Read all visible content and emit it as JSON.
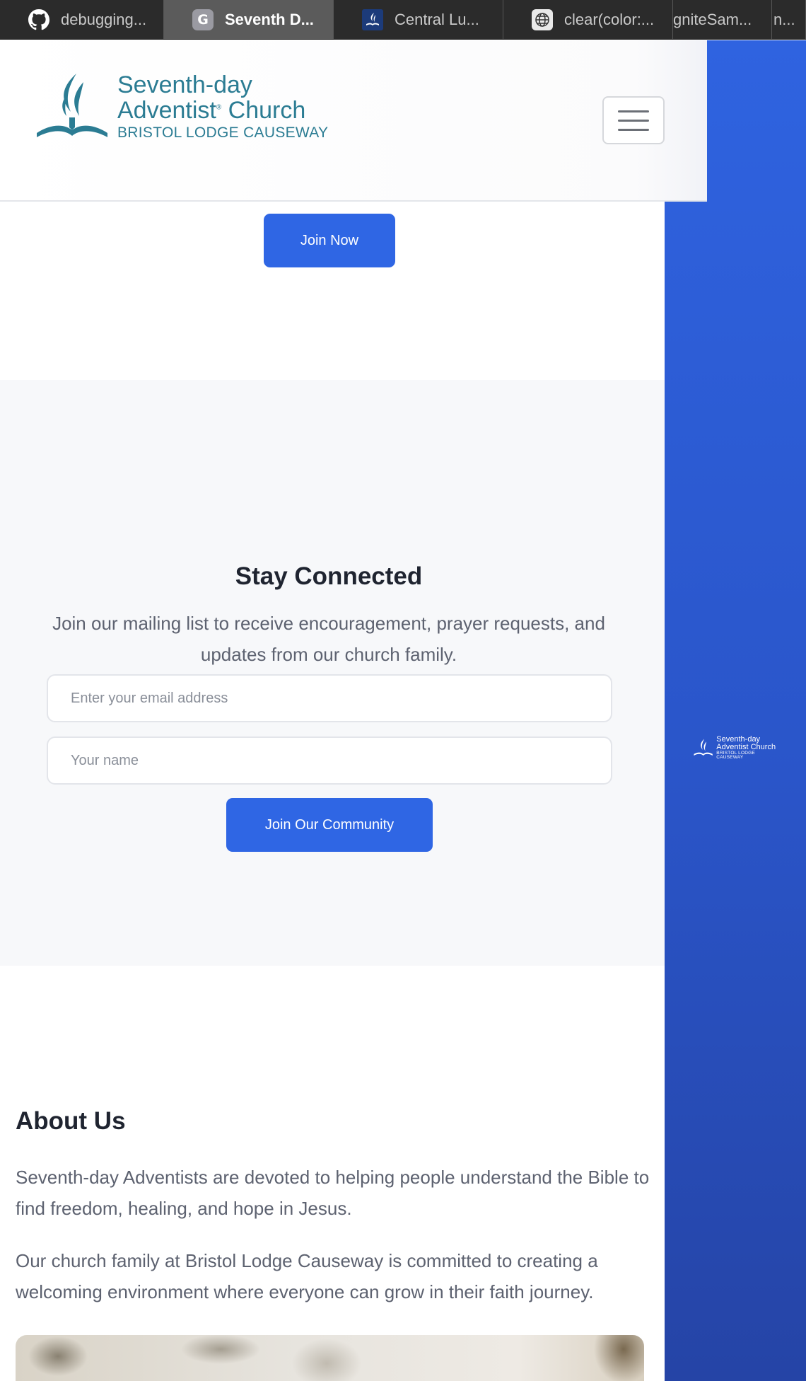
{
  "browser": {
    "tabs": [
      {
        "title": "debugging...",
        "icon": "github-icon",
        "active": false
      },
      {
        "title": "Seventh D...",
        "icon": "g-favicon-icon",
        "favicon_letter": "G",
        "active": true
      },
      {
        "title": "Central Lu...",
        "icon": "church-favicon-icon",
        "active": false
      },
      {
        "title": "clear(color:...",
        "icon": "globe-icon",
        "active": false
      },
      {
        "title": "gniteSam...",
        "icon": "",
        "active": false
      },
      {
        "title": "n...",
        "icon": "",
        "active": false
      }
    ]
  },
  "header": {
    "logo": {
      "line1": "Seventh-day",
      "line2": "Adventist",
      "line2_mark": "®",
      "line2_rest": " Church",
      "line3": "BRISTOL LODGE CAUSEWAY",
      "color": "#2b7c93"
    },
    "menu_icon": "hamburger-menu-icon"
  },
  "hero": {
    "join_button": "Join Now"
  },
  "newsletter": {
    "title": "Stay Connected",
    "description": "Join our mailing list to receive encouragement, prayer requests, and updates from our church family.",
    "email_placeholder": "Enter your email address",
    "name_placeholder": "Your name",
    "submit_button": "Join Our Community"
  },
  "about": {
    "title": "About Us",
    "paragraphs": [
      "Seventh-day Adventists are devoted to helping people understand the Bible to find freedom, healing, and hope in Jesus.",
      "Our church family at Bristol Lodge Causeway is committed to creating a welcoming environment where everyone can grow in their faith journey."
    ]
  },
  "side_panel": {
    "logo": {
      "line1": "Seventh-day",
      "line2": "Adventist Church",
      "line3": "BRISTOL LODGE CAUSEWAY"
    }
  },
  "colors": {
    "accent": "#2f66e4",
    "brand_teal": "#2b7c93",
    "heading": "#1f2430",
    "body_text": "#5d6270",
    "section_alt_bg": "#f7f8fa"
  }
}
